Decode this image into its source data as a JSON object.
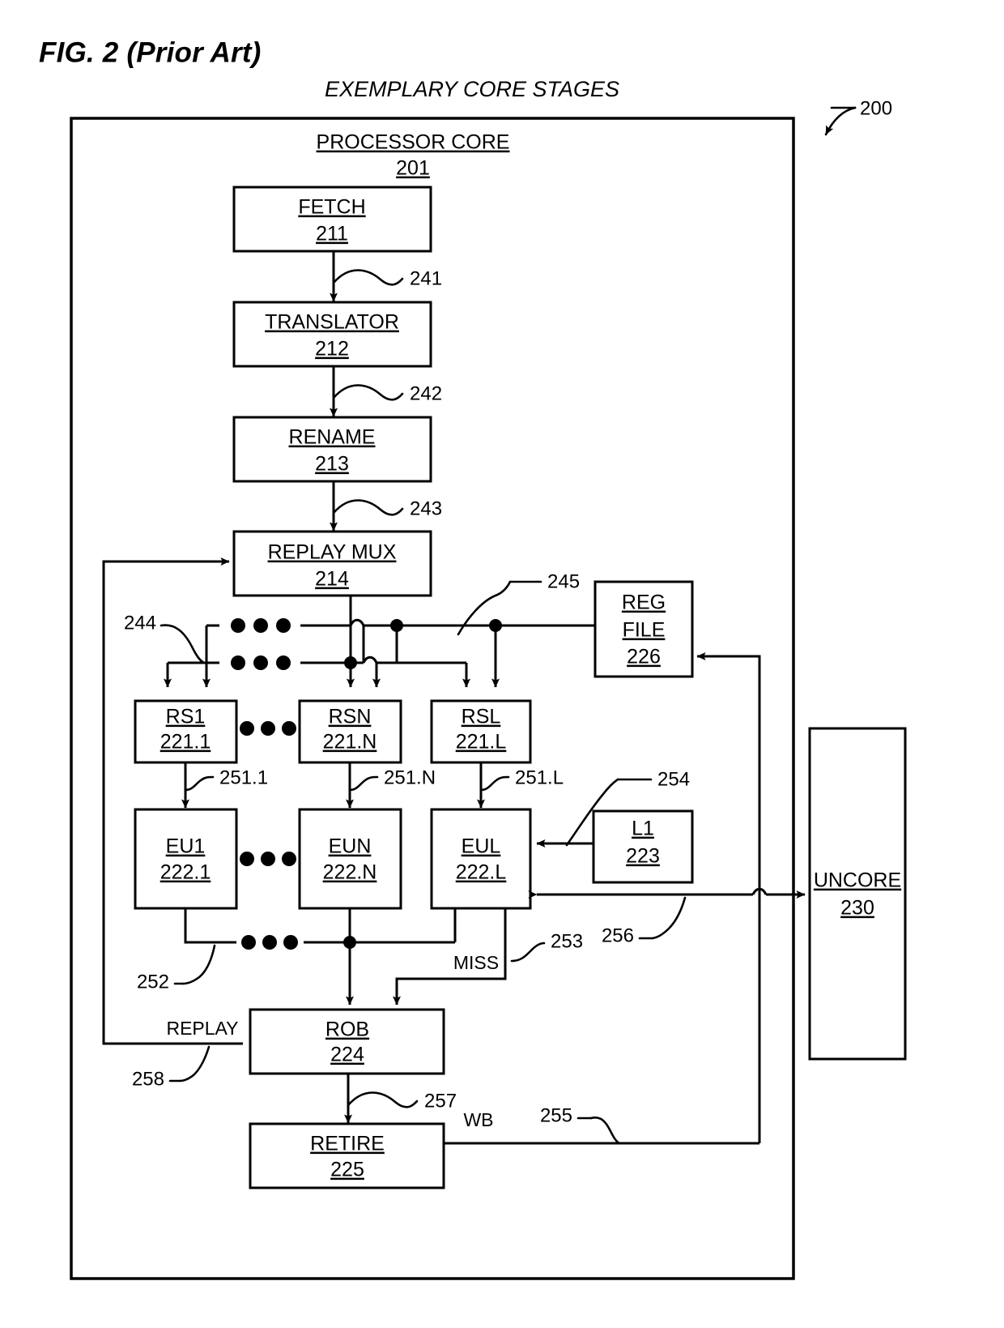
{
  "figure": {
    "label": "FIG. 2 (Prior Art)",
    "title": "EXEMPLARY CORE STAGES",
    "system_ref": "200"
  },
  "core": {
    "title": "PROCESSOR CORE",
    "ref": "201"
  },
  "blocks": {
    "fetch": {
      "label": "FETCH",
      "ref": "211"
    },
    "translator": {
      "label": "TRANSLATOR",
      "ref": "212"
    },
    "rename": {
      "label": "RENAME",
      "ref": "213"
    },
    "replay_mux": {
      "label": "REPLAY MUX",
      "ref": "214"
    },
    "rs1": {
      "label": "RS1",
      "ref": "221.1"
    },
    "rsn": {
      "label": "RSN",
      "ref": "221.N"
    },
    "rsl": {
      "label": "RSL",
      "ref": "221.L"
    },
    "eu1": {
      "label": "EU1",
      "ref": "222.1"
    },
    "eun": {
      "label": "EUN",
      "ref": "222.N"
    },
    "eul": {
      "label": "EUL",
      "ref": "222.L"
    },
    "l1": {
      "label": "L1",
      "ref": "223"
    },
    "rob": {
      "label": "ROB",
      "ref": "224"
    },
    "retire": {
      "label": "RETIRE",
      "ref": "225"
    },
    "reg_file": {
      "label_line1": "REG",
      "label_line2": "FILE",
      "ref": "226"
    },
    "uncore": {
      "label": "UNCORE",
      "ref": "230"
    }
  },
  "signal_refs": {
    "r241": "241",
    "r242": "242",
    "r243": "243",
    "r244": "244",
    "r245": "245",
    "r251_1": "251.1",
    "r251_n": "251.N",
    "r251_l": "251.L",
    "r252": "252",
    "r253": "253",
    "r254": "254",
    "r255": "255",
    "r256": "256",
    "r257": "257",
    "r258": "258"
  },
  "signal_names": {
    "miss": "MISS",
    "replay": "REPLAY",
    "wb": "WB"
  },
  "colors": {
    "ink": "#000000",
    "paper": "#ffffff"
  }
}
